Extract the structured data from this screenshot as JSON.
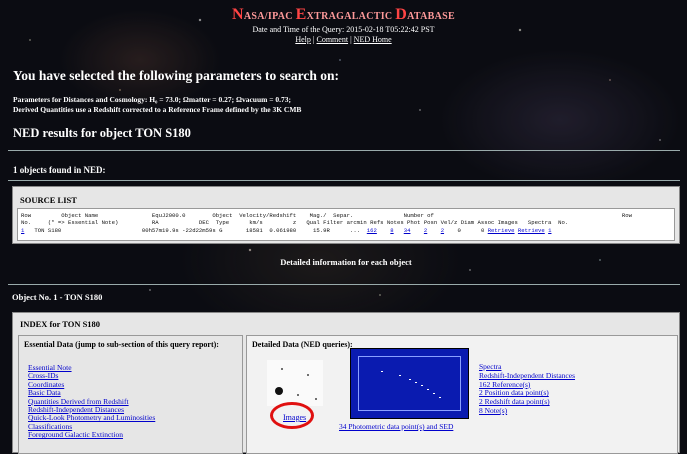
{
  "header": {
    "title_n": "N",
    "title_asa": "ASA/IPAC ",
    "title_e": "E",
    "title_xtra": "XTRAGALACTIC ",
    "title_d": "D",
    "title_atabase": "ATABASE",
    "date_line": "Date and Time of the Query: 2015-02-18 T05:22:42 PST",
    "nav": {
      "help": "Help",
      "comment": "Comment",
      "ned_home": "NED Home",
      "separator": "|"
    }
  },
  "params": {
    "heading": "You have selected the following parameters to search on:",
    "line1": "Parameters for Distances and Cosmology: H₀ = 73.0; Ωmatter = 0.27; Ωvacuum = 0.73;",
    "line2": "Derived Quantities use a Redshift corrected to a Reference Frame defined by the 3K CMB"
  },
  "results": {
    "heading": "NED results for object TON S180",
    "found": "1 objects found in NED:"
  },
  "source_list": {
    "title": "SOURCE LIST",
    "header1": "Row         Object Name                EquJ2000.0        Object  Velocity/Redshift    Mag./  Separ.               Number of                                                        Row",
    "header2": "No.     (* => Essential Note)          RA            DEC  Type      km/s         z   Qual Filter arcmin Refs Notes Phot Posn Vel/z Diam Assoc Images   Spectra  No.",
    "row": {
      "no": "1",
      "name": "   TON S180                        ",
      "coords": "00h57m19.9s -22d22m59s G       18581  0.061980     15.9R      ... ",
      "refs": "162",
      "notes": "8",
      "phot": "34",
      "posn": "2",
      "velz": "2",
      "diam_assoc": "    0      0 ",
      "images": "Retrieve",
      "spectra": "Retrieve",
      "row_no": "1"
    }
  },
  "detailed_heading": "Detailed information for each object",
  "object": {
    "title": "Object No. 1 - TON S180",
    "index_title": "INDEX for TON S180",
    "essential_title": "Essential Data (jump to sub-section of this query report):",
    "essential_links": [
      "Essential Note",
      "Cross-IDs",
      "Coordinates",
      "Basic Data",
      "Quantities Derived from Redshift",
      "Redshift-Independent Distances",
      "Quick-Look Photometry and Luminosities",
      "Classifications",
      "Foreground Galactic Extinction"
    ],
    "detailed_title": "Detailed Data (NED queries):",
    "images_link": "Images",
    "sed_link": "34 Photometric data point(s) and SED",
    "detail_links": [
      "Spectra",
      "Redshift-Independent Distances",
      "162 Reference(s)",
      "2 Position data point(s)",
      "2 Redshift data point(s)",
      "8 Note(s)"
    ]
  },
  "colors": {
    "link": "#0000cc",
    "highlight_ring": "#e01010",
    "sed_bg": "#0a1bb0"
  }
}
